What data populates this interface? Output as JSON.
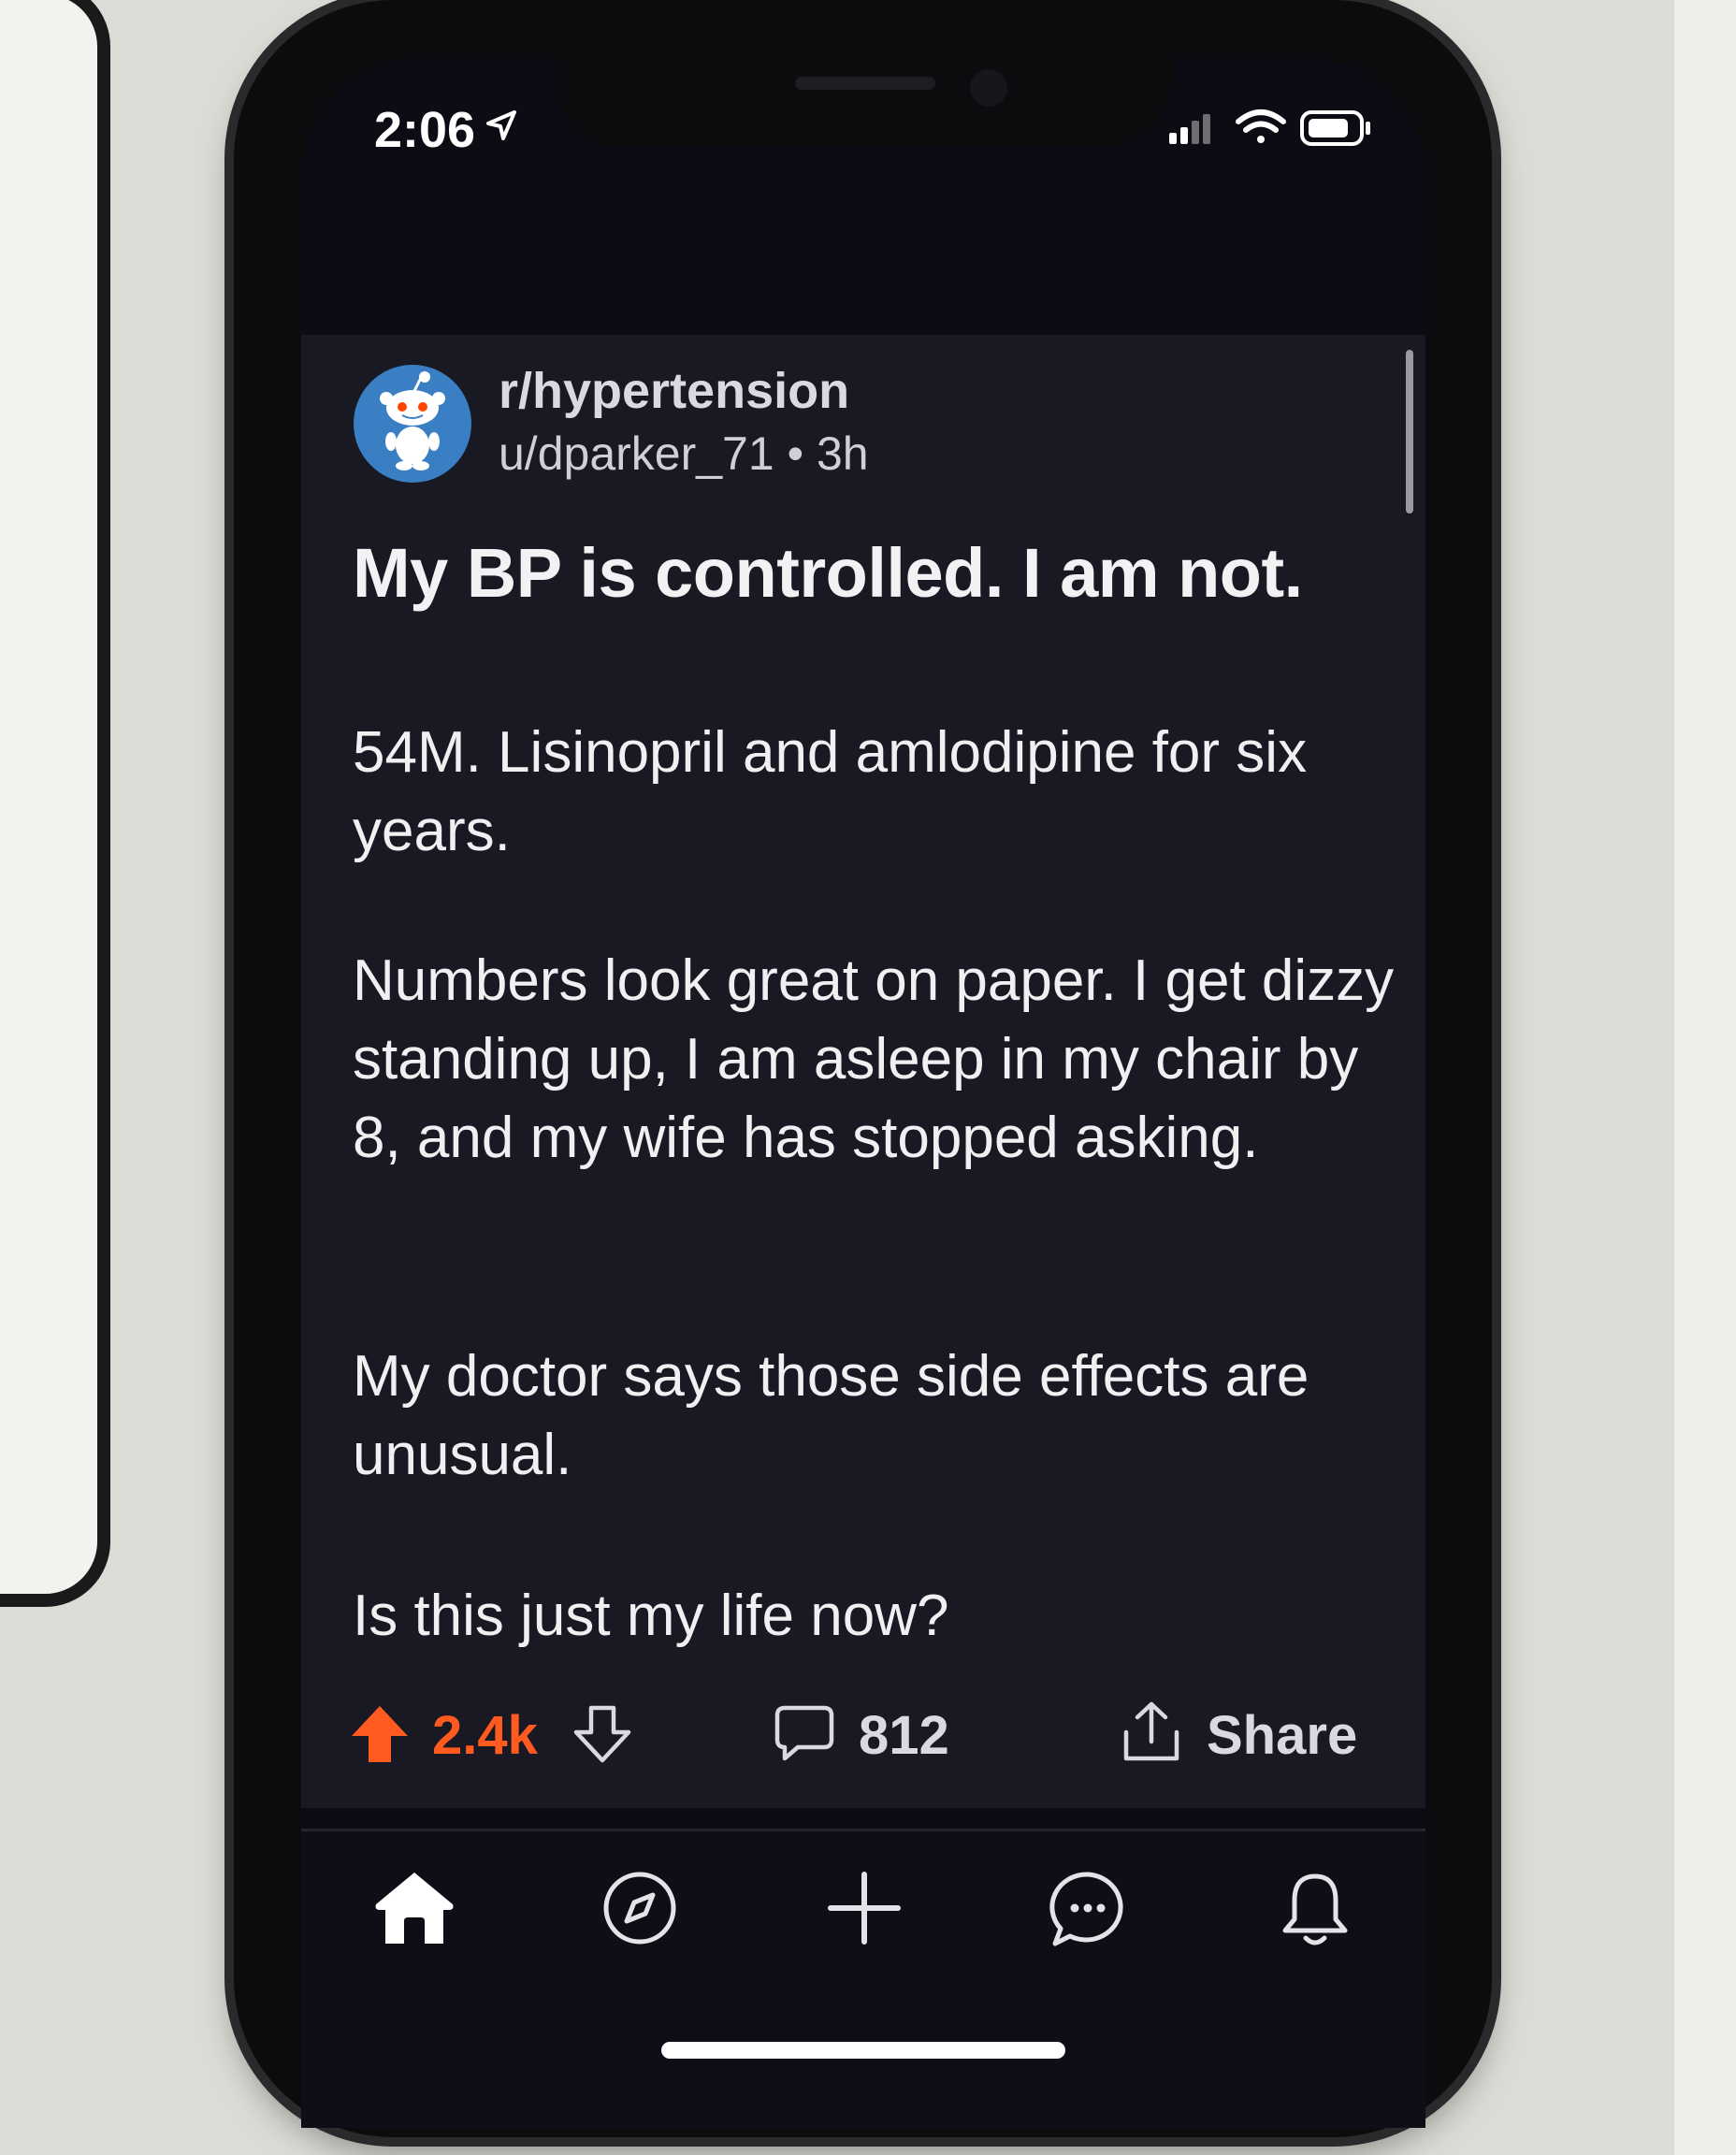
{
  "status_bar": {
    "time": "2:06"
  },
  "post": {
    "subreddit": "r/hypertension",
    "author": "u/dparker_71",
    "separator": "•",
    "age": "3h",
    "title": "My BP is controlled. I am not.",
    "paragraphs": [
      "54M. Lisinopril and amlodipine for six years.",
      "Numbers look great on paper. I get dizzy standing up, I am asleep in my chair by 8, and my wife has stopped asking.",
      "My doctor says those side effects are unusual.",
      "Is this just my life now?"
    ]
  },
  "actions": {
    "votes": "2.4k",
    "comments": "812",
    "share_label": "Share"
  },
  "colors": {
    "upvote_accent": "#ff5a1f",
    "post_background": "#181922",
    "avatar_blue": "#3a7fc3"
  },
  "tab_bar": {
    "tabs": [
      "home-icon",
      "compass-icon",
      "plus-icon",
      "chat-icon",
      "bell-icon"
    ],
    "active": "home-icon"
  }
}
